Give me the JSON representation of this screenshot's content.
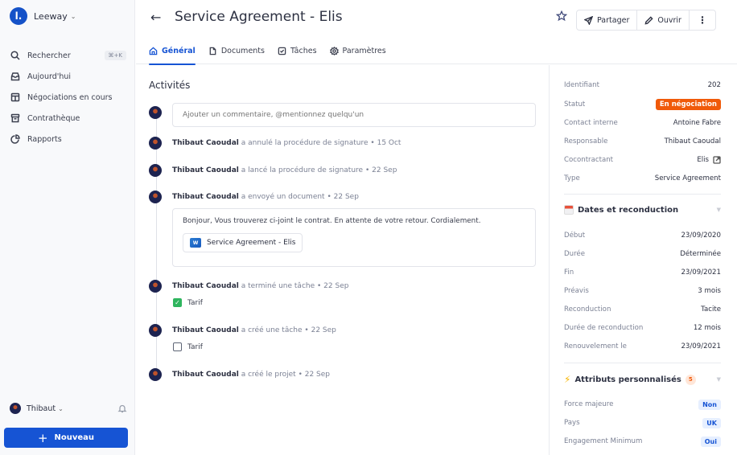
{
  "sidebar": {
    "brand": {
      "logo_letter": "l.",
      "name": "Leeway",
      "chevron": "⌄"
    },
    "nav": [
      {
        "label": "Rechercher",
        "icon": "search-icon",
        "shortcut": "⌘+K"
      },
      {
        "label": "Aujourd'hui",
        "icon": "inbox-icon"
      },
      {
        "label": "Négociations en cours",
        "icon": "layout-icon"
      },
      {
        "label": "Contrathèque",
        "icon": "archive-icon"
      },
      {
        "label": "Rapports",
        "icon": "pie-chart-icon"
      }
    ],
    "user": {
      "name": "Thibaut",
      "chevron": "⌄"
    },
    "new_button": {
      "plus": "+",
      "label": "Nouveau"
    }
  },
  "header": {
    "back": "←",
    "title": "Service Agreement - Elis",
    "actions": {
      "share": "Partager",
      "open": "Ouvrir",
      "more": "⋮"
    },
    "tabs": [
      {
        "label": "Général",
        "active": true
      },
      {
        "label": "Documents"
      },
      {
        "label": "Tâches"
      },
      {
        "label": "Paramètres"
      }
    ]
  },
  "activities": {
    "title": "Activités",
    "comment_placeholder": "Ajouter un commentaire, @mentionnez quelqu'un",
    "items": [
      {
        "actor": "Thibaut Caoudal",
        "action": "a annulé la procédure de signature",
        "date": "• 15 Oct"
      },
      {
        "actor": "Thibaut Caoudal",
        "action": "a lancé la procédure de signature",
        "date": "• 22 Sep"
      },
      {
        "actor": "Thibaut Caoudal",
        "action": "a envoyé un document",
        "date": "• 22 Sep",
        "message": "Bonjour, Vous trouverez ci-joint le contrat. En attente de votre retour. Cordialement.",
        "attachment": "Service Agreement - Elis",
        "attachment_icon": "W"
      },
      {
        "actor": "Thibaut Caoudal",
        "action": "a terminé une tâche",
        "date": "• 22 Sep",
        "task": "Tarif",
        "task_done": true,
        "check": "✓"
      },
      {
        "actor": "Thibaut Caoudal",
        "action": "a créé une tâche",
        "date": "• 22 Sep",
        "task": "Tarif",
        "task_done": false
      },
      {
        "actor": "Thibaut Caoudal",
        "action": "a créé le projet",
        "date": "• 22 Sep"
      }
    ]
  },
  "details": {
    "fields": [
      {
        "label": "Identifiant",
        "value": "202"
      },
      {
        "label": "Statut",
        "value": "En négociation",
        "color": "#f05a0a"
      },
      {
        "label": "Contact interne",
        "value": "Antoine Fabre"
      },
      {
        "label": "Responsable",
        "value": "Thibaut Caoudal"
      },
      {
        "label": "Cocontractant",
        "value": "Elis"
      },
      {
        "label": "Type",
        "value": "Service Agreement"
      }
    ],
    "dates": {
      "title": "Dates et reconduction",
      "caret": "▼",
      "fields": [
        {
          "label": "Début",
          "value": "23/09/2020"
        },
        {
          "label": "Durée",
          "value": "Déterminée"
        },
        {
          "label": "Fin",
          "value": "23/09/2021"
        },
        {
          "label": "Préavis",
          "value": "3 mois"
        },
        {
          "label": "Reconduction",
          "value": "Tacite"
        },
        {
          "label": "Durée de reconduction",
          "value": "12 mois"
        },
        {
          "label": "Renouvelement le",
          "value": "23/09/2021"
        }
      ]
    },
    "attributes": {
      "title": "Attributs personnalisés",
      "bolt": "⚡",
      "count": "5",
      "caret": "▼",
      "fields": [
        {
          "label": "Force majeure",
          "value": "Non"
        },
        {
          "label": "Pays",
          "value": "UK"
        },
        {
          "label": "Engagement Minimum",
          "value": "Oui"
        }
      ]
    }
  }
}
